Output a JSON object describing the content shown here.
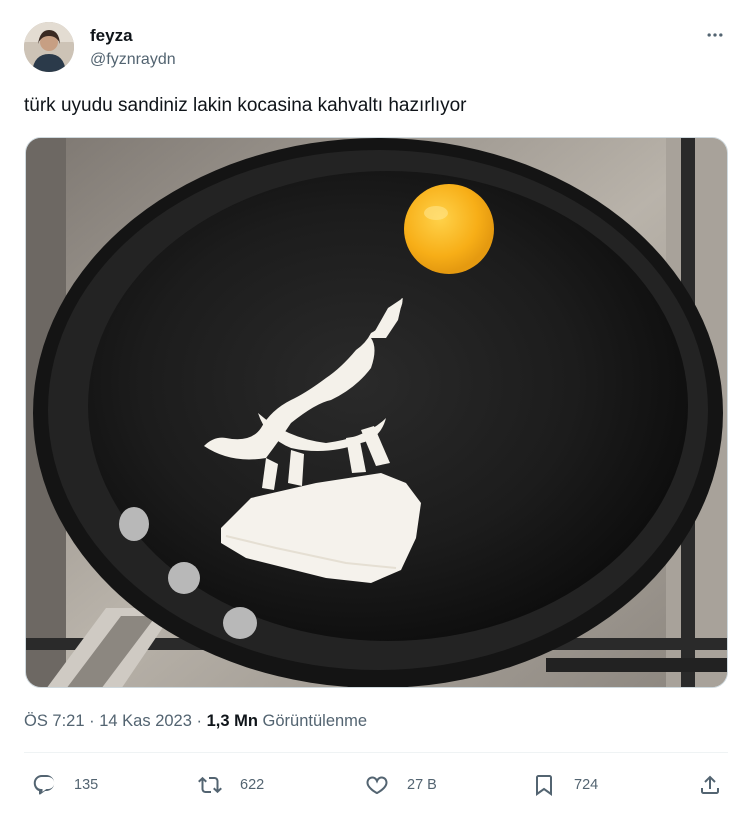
{
  "user": {
    "display_name": "feyza",
    "handle": "@fyznraydn"
  },
  "tweet": {
    "text": "türk uyudu sandiniz lakin kocasina kahvaltı hazırlıyor"
  },
  "meta": {
    "time": "ÖS 7:21",
    "date": "14 Kas 2023",
    "views_count": "1,3 Mn",
    "views_label": "Görüntülenme",
    "separator": "·"
  },
  "actions": {
    "replies": "135",
    "reposts": "622",
    "likes": "27 B",
    "bookmarks": "724"
  },
  "icons": {
    "more": "more-horizontal-icon",
    "reply": "reply-icon",
    "repost": "repost-icon",
    "like": "heart-icon",
    "bookmark": "bookmark-icon",
    "share": "share-icon"
  },
  "colors": {
    "text_primary": "#0f1419",
    "text_secondary": "#536471",
    "divider": "#eff3f4"
  }
}
